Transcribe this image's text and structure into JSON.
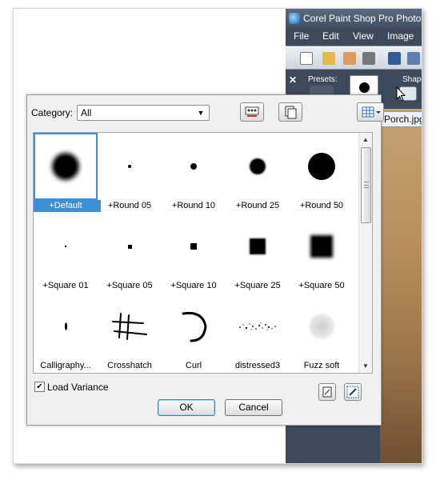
{
  "app": {
    "title": "Corel Paint Shop Pro Photo",
    "menu": [
      "File",
      "Edit",
      "View",
      "Image"
    ],
    "presets_label": "Presets:",
    "shape_label": "Shape",
    "document_tab": "Porch.jpg"
  },
  "dialog": {
    "category_label": "Category:",
    "category_value": "All",
    "load_variance_label": "Load Variance",
    "load_variance_checked": true,
    "ok_label": "OK",
    "cancel_label": "Cancel",
    "brushes": [
      {
        "label": "+Default",
        "selected": true
      },
      {
        "label": "+Round 05"
      },
      {
        "label": "+Round 10"
      },
      {
        "label": "+Round 25"
      },
      {
        "label": "+Round 50"
      },
      {
        "label": "+Square 01"
      },
      {
        "label": "+Square 05"
      },
      {
        "label": "+Square 10"
      },
      {
        "label": "+Square 25"
      },
      {
        "label": "+Square 50"
      },
      {
        "label": "Calligraphy..."
      },
      {
        "label": "Crosshatch"
      },
      {
        "label": "Curl"
      },
      {
        "label": "distressed3"
      },
      {
        "label": "Fuzz soft"
      }
    ]
  },
  "colors": {
    "selection": "#3b8fd6",
    "app_chrome": "#3c4a5c"
  }
}
